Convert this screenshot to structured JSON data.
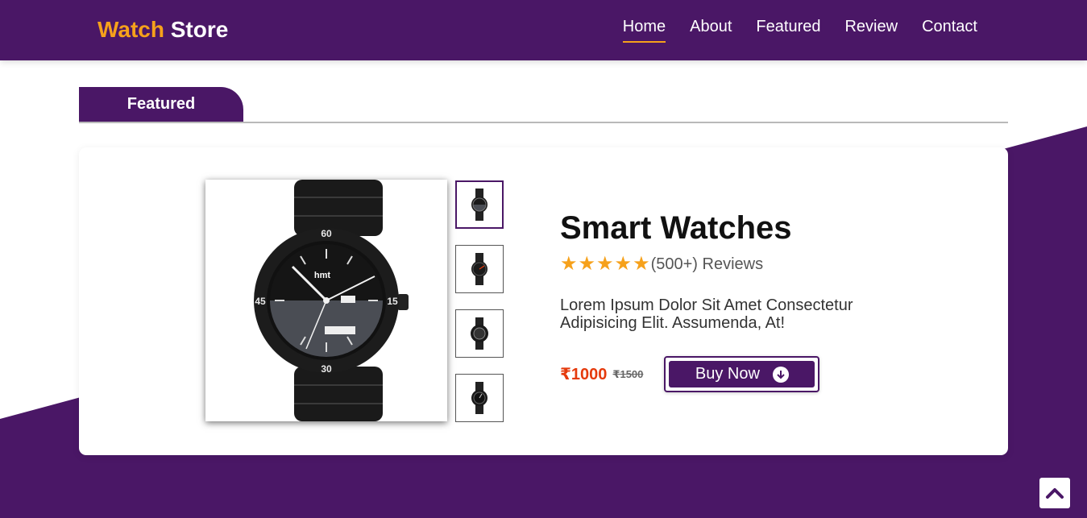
{
  "header": {
    "logo_accent": "Watch",
    "logo_rest": " Store",
    "nav": [
      "Home",
      "About",
      "Featured",
      "Review",
      "Contact"
    ],
    "active_nav": "Home"
  },
  "section": {
    "tab_label": "Featured"
  },
  "product": {
    "title": "Smart Watches",
    "stars": 5,
    "reviews": "(500+) Reviews",
    "description": "Lorem Ipsum Dolor Sit Amet Consectetur Adipisicing Elit. Assumenda, At!",
    "price": "₹1000",
    "old_price": "₹1500",
    "buy_label": "Buy Now",
    "main_image_brand": "hmt",
    "main_image_numbers": [
      "60",
      "15",
      "30",
      "45"
    ],
    "thumbnail_count": 4,
    "selected_thumbnail": 1
  },
  "colors": {
    "brand_purple": "#4a1766",
    "accent_orange": "#f6a11b",
    "price_red": "#e53a0c"
  },
  "icons": {
    "buy": "arrow-down-circle-icon",
    "scroll_top": "chevron-up-icon",
    "star": "star-icon"
  }
}
